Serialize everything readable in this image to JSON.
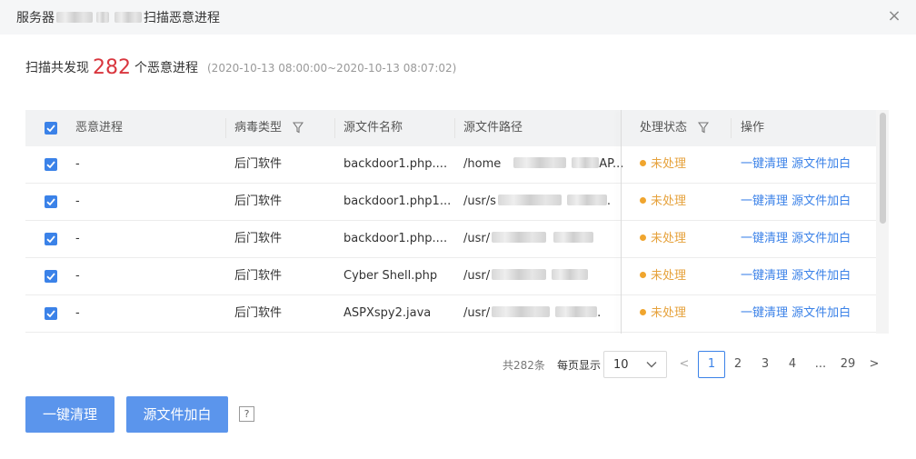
{
  "dialog": {
    "title_prefix": "服务器",
    "title_suffix": "扫描恶意进程",
    "close_glyph": "×"
  },
  "summary": {
    "label_before": "扫描共发现",
    "count": "282",
    "label_after": "个恶意进程",
    "time_range": "(2020-10-13 08:00:00~2020-10-13 08:07:02)"
  },
  "table": {
    "columns": {
      "process": "恶意进程",
      "virus_type": "病毒类型",
      "file_name": "源文件名称",
      "file_path": "源文件路径",
      "status": "处理状态",
      "action": "操作"
    },
    "rows": [
      {
        "process": "-",
        "virus_type": "后门软件",
        "file_name": "backdoor1.php....",
        "path_prefix": "/home",
        "path_suffix": "AP...",
        "status": "未处理",
        "action_clean": "一键清理",
        "action_whitelist": "源文件加白"
      },
      {
        "process": "-",
        "virus_type": "后门软件",
        "file_name": "backdoor1.php1...",
        "path_prefix": "/usr/s",
        "path_suffix": ".",
        "status": "未处理",
        "action_clean": "一键清理",
        "action_whitelist": "源文件加白"
      },
      {
        "process": "-",
        "virus_type": "后门软件",
        "file_name": "backdoor1.php....",
        "path_prefix": "/usr/",
        "path_suffix": "",
        "status": "未处理",
        "action_clean": "一键清理",
        "action_whitelist": "源文件加白"
      },
      {
        "process": "-",
        "virus_type": "后门软件",
        "file_name": "Cyber Shell.php",
        "path_prefix": "/usr/",
        "path_suffix": "",
        "status": "未处理",
        "action_clean": "一键清理",
        "action_whitelist": "源文件加白"
      },
      {
        "process": "-",
        "virus_type": "后门软件",
        "file_name": "ASPXspy2.java",
        "path_prefix": "/usr/",
        "path_suffix": ".",
        "status": "未处理",
        "action_clean": "一键清理",
        "action_whitelist": "源文件加白"
      }
    ]
  },
  "pagination": {
    "total": "共282条",
    "per_page_label": "每页显示",
    "per_page_value": "10",
    "prev": "<",
    "pages": [
      "1",
      "2",
      "3",
      "4",
      "...",
      "29"
    ],
    "next": ">",
    "current": "1"
  },
  "actions": {
    "clean_all": "一键清理",
    "whitelist": "源文件加白",
    "help": "?"
  },
  "colors": {
    "primary": "#3b82e8",
    "button": "#5b95ec",
    "danger_count": "#d9363e",
    "status_pending": "#f0a52e"
  }
}
